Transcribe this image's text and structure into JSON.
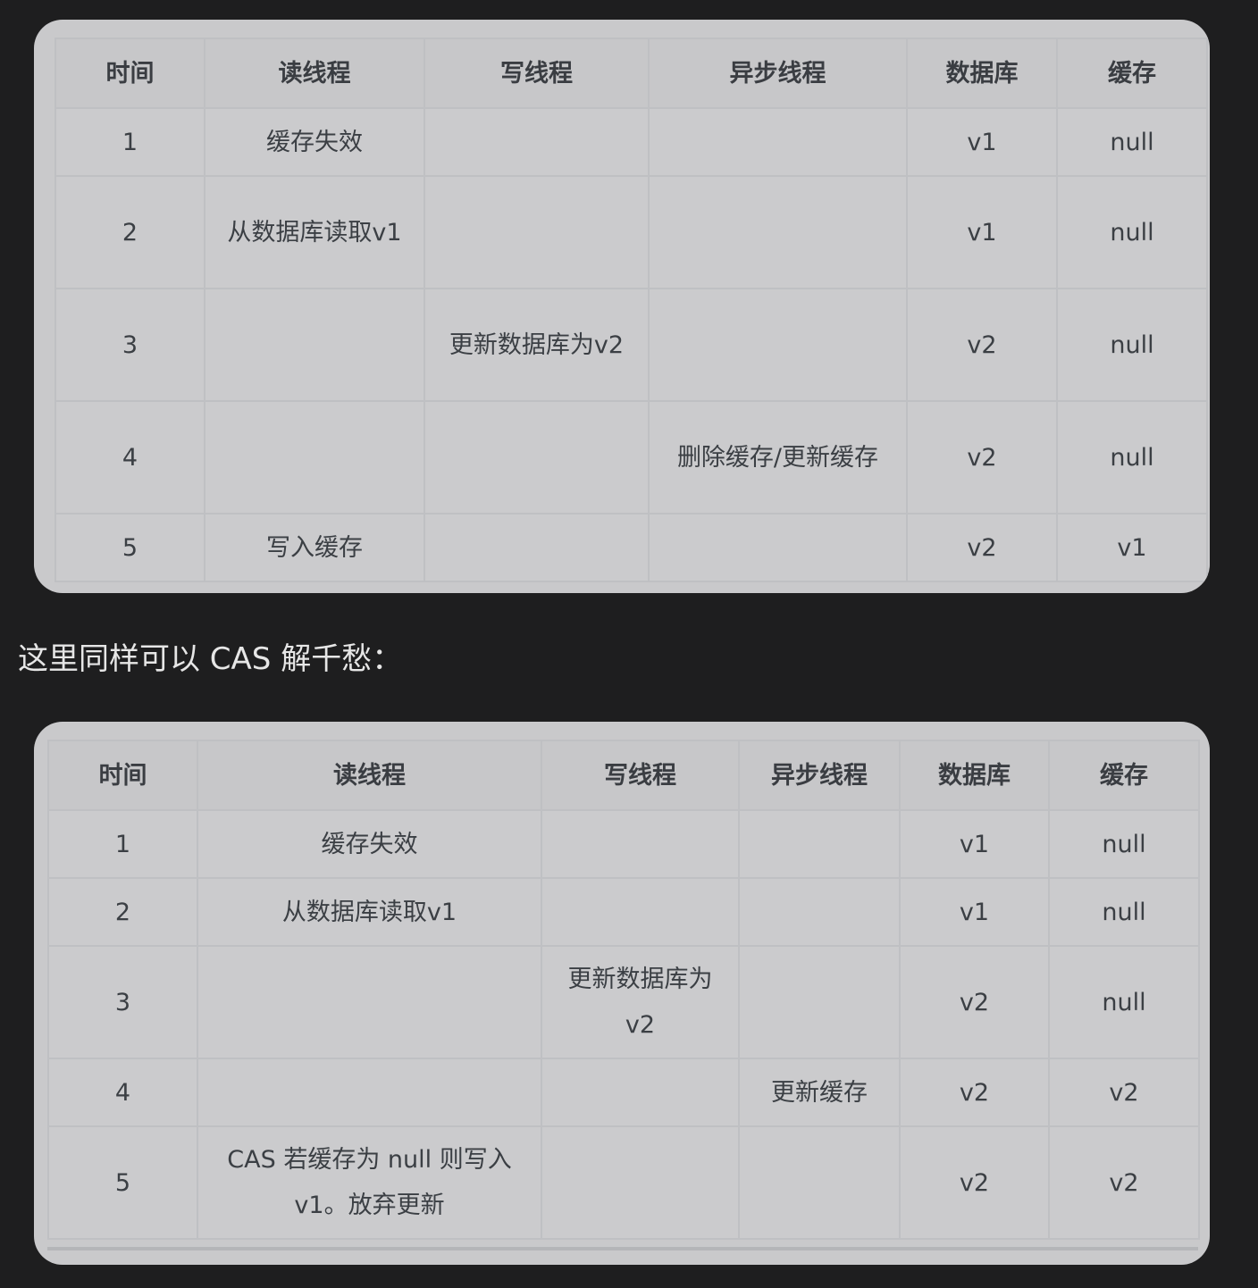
{
  "table1": {
    "headers": [
      "时间",
      "读线程",
      "写线程",
      "异步线程",
      "数据库",
      "缓存"
    ],
    "rows": [
      [
        "1",
        "缓存失效",
        "",
        "",
        "v1",
        "null"
      ],
      [
        "2",
        "从数据库读取v1",
        "",
        "",
        "v1",
        "null"
      ],
      [
        "3",
        "",
        "更新数据库为v2",
        "",
        "v2",
        "null"
      ],
      [
        "4",
        "",
        "",
        "删除缓存/更新缓存",
        "v2",
        "null"
      ],
      [
        "5",
        "写入缓存",
        "",
        "",
        "v2",
        "v1"
      ]
    ]
  },
  "caption": "这里同样可以 CAS 解千愁：",
  "table2": {
    "headers": [
      "时间",
      "读线程",
      "写线程",
      "异步线程",
      "数据库",
      "缓存"
    ],
    "rows": [
      [
        "1",
        "缓存失效",
        "",
        "",
        "v1",
        "null"
      ],
      [
        "2",
        "从数据库读取v1",
        "",
        "",
        "v1",
        "null"
      ],
      [
        "3",
        "",
        "更新数据库为v2",
        "",
        "v2",
        "null"
      ],
      [
        "4",
        "",
        "",
        "更新缓存",
        "v2",
        "v2"
      ],
      [
        "5",
        "CAS 若缓存为 null 则写入 v1。放弃更新",
        "",
        "",
        "v2",
        "v2"
      ]
    ]
  }
}
